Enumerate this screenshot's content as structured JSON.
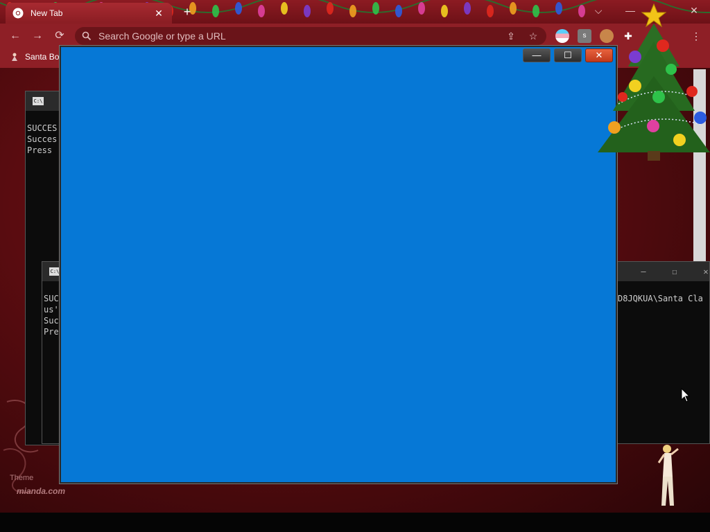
{
  "browser": {
    "tab_title": "New Tab",
    "tab_close": "✕",
    "new_tab": "+",
    "omnibox_placeholder": "Search Google or type a URL",
    "bookmark_label": "Santa Bo",
    "theme_label": "Theme",
    "theme_credit": "mianda.com",
    "window_controls": {
      "collapse": "⌵",
      "minimize": "—",
      "close": "✕"
    },
    "nav": {
      "back": "←",
      "forward": "→",
      "reload": "⟳"
    }
  },
  "console_back": {
    "lines": [
      "SUCCES",
      "Succes",
      "Press "
    ]
  },
  "console_front": {
    "lines": [
      "SUC",
      "us'",
      "Suc",
      "Pre"
    ],
    "right_text": "D8JQKUA\\Santa Cla",
    "controls": {
      "minimize": "—",
      "maximize": "☐",
      "close": "✕"
    }
  },
  "blue_window": {
    "color": "#0678d6",
    "controls": {
      "minimize": "—",
      "maximize": "☐",
      "close": "✕"
    }
  },
  "colors": {
    "chrome_red": "#8e1f26",
    "console_bg": "#0c0c0c",
    "close_orange": "#d9481f"
  }
}
